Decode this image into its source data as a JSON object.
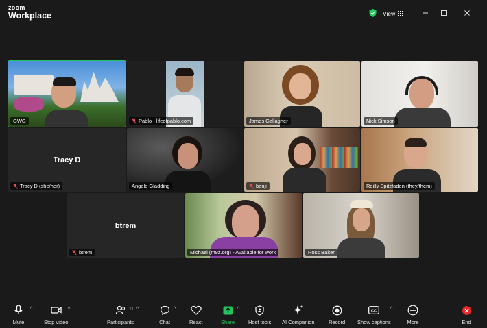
{
  "app": {
    "brand_top": "zoom",
    "brand_bottom": "Workplace",
    "view_label": "View"
  },
  "colors": {
    "active_border": "#22c55e",
    "share_green": "#22c55e",
    "end_red": "#e02828",
    "mute_red": "#e05050"
  },
  "tiles": {
    "gwg": {
      "name": "GWG",
      "muted": false
    },
    "pablo": {
      "name": "Pablo - lifeofpablo.com",
      "muted": true
    },
    "james": {
      "name": "James Gallagher",
      "muted": false
    },
    "nick": {
      "name": "Nick Simson",
      "muted": false
    },
    "tracy": {
      "name": "Tracy D (she/her)",
      "display_name": "Tracy D",
      "muted": true
    },
    "angelo": {
      "name": "Angelo Gladding",
      "muted": false
    },
    "benji": {
      "name": "benji",
      "muted": true
    },
    "reilly": {
      "name": "Reilly Spitzfaden (they/them)",
      "muted": false
    },
    "btrem": {
      "name": "btrem",
      "display_name": "btrem",
      "muted": true
    },
    "michael": {
      "name": "Michael (m9z.org) - Available for work",
      "muted": false
    },
    "ross": {
      "name": "Ross Baker",
      "muted": false
    }
  },
  "toolbar": {
    "mute": "Mute",
    "stop_video": "Stop video",
    "participants": "Participants",
    "participants_count": "11",
    "chat": "Chat",
    "react": "React",
    "share": "Share",
    "host_tools": "Host tools",
    "ai_companion": "AI Companion",
    "record": "Record",
    "show_captions": "Show captions",
    "more": "More",
    "end": "End"
  }
}
